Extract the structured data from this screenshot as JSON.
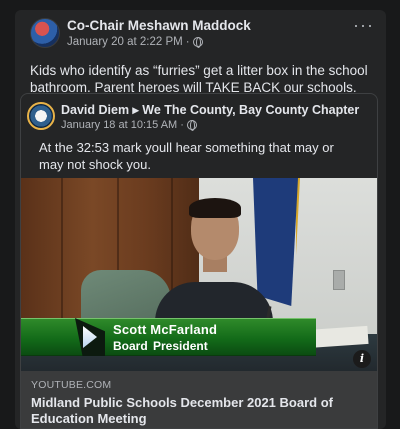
{
  "post": {
    "author": "Co-Chair Meshawn Maddock",
    "date": "January 20 at 2:22 PM",
    "separator": "·",
    "text": "Kids who identify as “furries” get a litter box in the school bathroom. Parent heroes will TAKE BACK our schools.",
    "more_label": "···"
  },
  "shared": {
    "author": "David Diem ▸ We The County, Bay County Chapter",
    "date": "January 18 at 10:15 AM",
    "separator": "·",
    "text": "At the 32:53 mark youll hear something that may or may not shock you."
  },
  "video": {
    "lower_third_name": "Scott McFarland",
    "lower_third_title": "Board President",
    "info_label": "i"
  },
  "link": {
    "domain": "YOUTUBE.COM",
    "title": "Midland Public Schools December 2021 Board of Education Meeting"
  },
  "icons": {
    "privacy": "globe-icon",
    "more": "more-options-icon",
    "info": "info-icon"
  },
  "colors": {
    "background": "#18191a",
    "card": "#242526",
    "text": "#e4e6eb",
    "muted": "#b0b3b8",
    "lower_third_green": "#136b19"
  }
}
